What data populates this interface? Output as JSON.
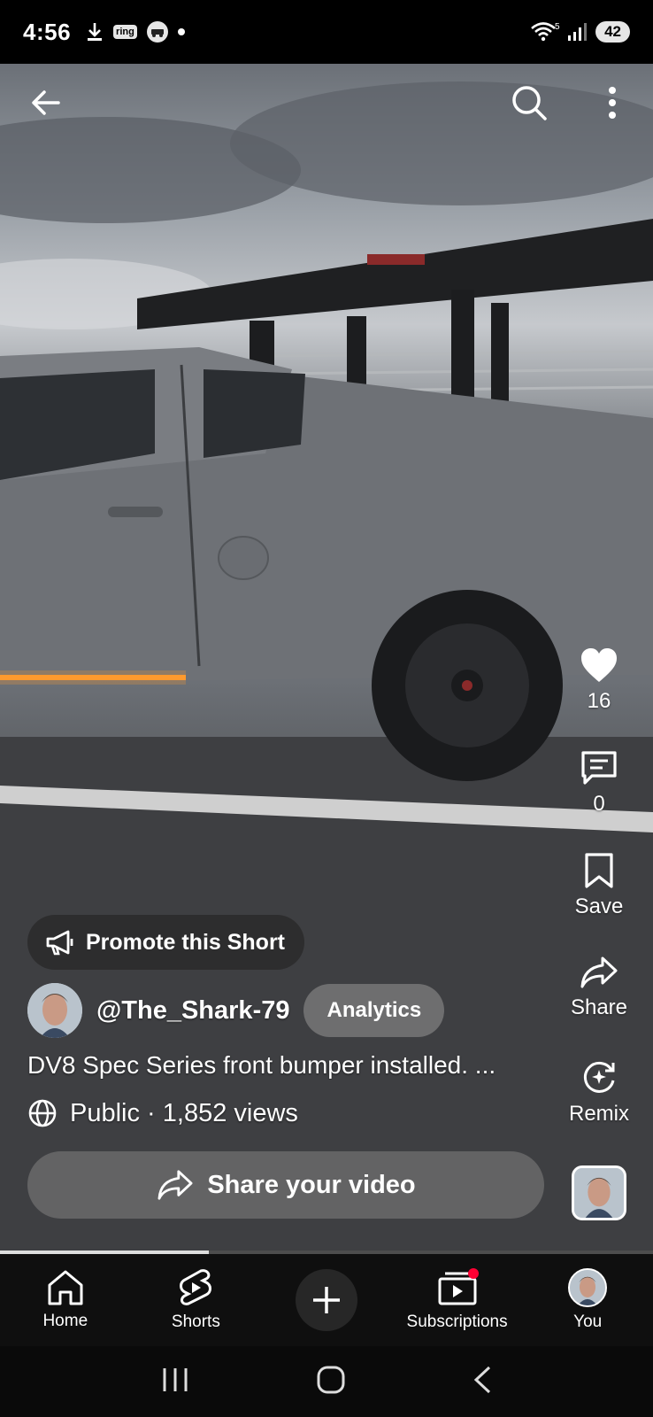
{
  "status_bar": {
    "time": "4:56",
    "ring_label": "ring",
    "network_superscript": "5",
    "battery": "42"
  },
  "top_bar": {
    "back_icon": "arrow-left-icon",
    "search_icon": "search-icon",
    "more_icon": "more-vert-icon"
  },
  "actions": {
    "like_count": "16",
    "comment_count": "0",
    "save_label": "Save",
    "share_label": "Share",
    "remix_label": "Remix"
  },
  "video_info": {
    "promote_label": "Promote this Short",
    "channel_handle": "@The_Shark-79",
    "analytics_label": "Analytics",
    "description": "DV8 Spec Series front bumper installed. ...",
    "visibility_views": "Public · 1,852 views",
    "share_video_label": "Share your video",
    "progress_fraction": 0.32
  },
  "bottom_nav": {
    "home": "Home",
    "shorts": "Shorts",
    "subscriptions": "Subscriptions",
    "you": "You"
  },
  "colors": {
    "notification_dot": "#ff0033",
    "nav_bg": "#0f0f0f"
  }
}
